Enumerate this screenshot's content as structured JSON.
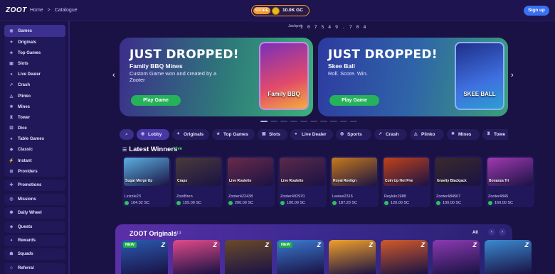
{
  "header": {
    "logo": "ZOOT",
    "breadcrumbs": [
      "Home",
      ">",
      "Catalogue"
    ],
    "store_label": "STORE",
    "balance": "10.0K GC",
    "jackpot_label": "Jackpot",
    "jackpot_value": "2 0 7 5 4 9 . 7 0 4",
    "signup_label": "Sign up"
  },
  "sidebar": {
    "games_group": [
      {
        "label": "Games",
        "icon": "gamepad-icon"
      },
      {
        "label": "Originals",
        "icon": "zoot-icon"
      },
      {
        "label": "Top Games",
        "icon": "star-icon"
      },
      {
        "label": "Slots",
        "icon": "slots-icon"
      },
      {
        "label": "Live Dealer",
        "icon": "dealer-icon"
      },
      {
        "label": "Crash",
        "icon": "rocket-icon"
      },
      {
        "label": "Plinko",
        "icon": "plinko-icon"
      },
      {
        "label": "Mines",
        "icon": "mine-icon"
      },
      {
        "label": "Tower",
        "icon": "tower-icon"
      },
      {
        "label": "Dice",
        "icon": "dice-icon"
      },
      {
        "label": "Table Games",
        "icon": "cards-icon"
      },
      {
        "label": "Classic",
        "icon": "classic-icon"
      },
      {
        "label": "Instant",
        "icon": "instant-icon"
      },
      {
        "label": "Providers",
        "icon": "providers-icon"
      }
    ],
    "promotions": "Promotions",
    "missions": "Missions",
    "daily_wheel": "Daily Wheel",
    "quests": "Quests",
    "rewards": "Rewards",
    "squads": "Squads",
    "referral": "Referral"
  },
  "banners": [
    {
      "title": "JUST DROPPED!",
      "subtitle": "Family BBQ Mines",
      "desc": "Custom Game won and created by a Zooter",
      "button": "Play Game",
      "art_label": "Family BBQ"
    },
    {
      "title": "JUST DROPPED!",
      "subtitle": "Skee Ball",
      "desc": "Roll. Score. Win.",
      "button": "Play Game",
      "art_label": "SKEE BALL"
    }
  ],
  "nav": {
    "prev": "‹",
    "next": "›"
  },
  "tabs": [
    {
      "label": "Lobby",
      "icon": "gamepad-icon"
    },
    {
      "label": "Originals",
      "icon": "zoot-icon"
    },
    {
      "label": "Top Games",
      "icon": "star-icon"
    },
    {
      "label": "Slots",
      "icon": "slots-icon"
    },
    {
      "label": "Live Dealer",
      "icon": "dealer-icon"
    },
    {
      "label": "Sports",
      "icon": "ball-icon"
    },
    {
      "label": "Crash",
      "icon": "rocket-icon"
    },
    {
      "label": "Plinko",
      "icon": "plinko-icon"
    },
    {
      "label": "Mines",
      "icon": "mine-icon"
    },
    {
      "label": "Towe",
      "icon": "tower-icon"
    }
  ],
  "winners": {
    "title": "Latest Winners",
    "live": "Live",
    "items": [
      {
        "game": "Sugar Merge Up",
        "user": "Lzizzle23",
        "amount": "104.32 SC",
        "color": "#5ab0e0"
      },
      {
        "game": "Craps",
        "user": "ZootBren",
        "amount": "155.00 SC",
        "color": "#4a3a3a"
      },
      {
        "game": "Live Roulette",
        "user": "Zooter422438",
        "amount": "200.00 SC",
        "color": "#6a2a4a"
      },
      {
        "game": "Live Roulette",
        "user": "Zooter492970",
        "amount": "100.00 SC",
        "color": "#5a2a4a"
      },
      {
        "game": "Royal Reelign",
        "user": "Leelee2316",
        "amount": "187.20 SC",
        "color": "#c77a1a"
      },
      {
        "game": "Coin Up Hot Fire",
        "user": "Reylulo1988",
        "amount": "120.00 SC",
        "color": "#c0421a"
      },
      {
        "game": "Gravity Blackjack",
        "user": "Zooter484567",
        "amount": "100.00 SC",
        "color": "#3a2a2a"
      },
      {
        "game": "Bonanza Tri",
        "user": "Zooter4845",
        "amount": "160.00 SC",
        "color": "#a03ab0"
      }
    ]
  },
  "originals": {
    "title": "ZOOT Originals",
    "count": "113",
    "all": "All",
    "prev": "‹",
    "next": "›",
    "cards": [
      {
        "badge": "NEW",
        "color": "#2a5ab0"
      },
      {
        "badge": "",
        "color": "#e04a8a"
      },
      {
        "badge": "",
        "color": "#6a4a2a"
      },
      {
        "badge": "NEW",
        "color": "#3a7ad0"
      },
      {
        "badge": "",
        "color": "#f0a02a"
      },
      {
        "badge": "",
        "color": "#d05a2a"
      },
      {
        "badge": "",
        "color": "#8a3ab0"
      },
      {
        "badge": "",
        "color": "#3a8ad0"
      }
    ]
  }
}
